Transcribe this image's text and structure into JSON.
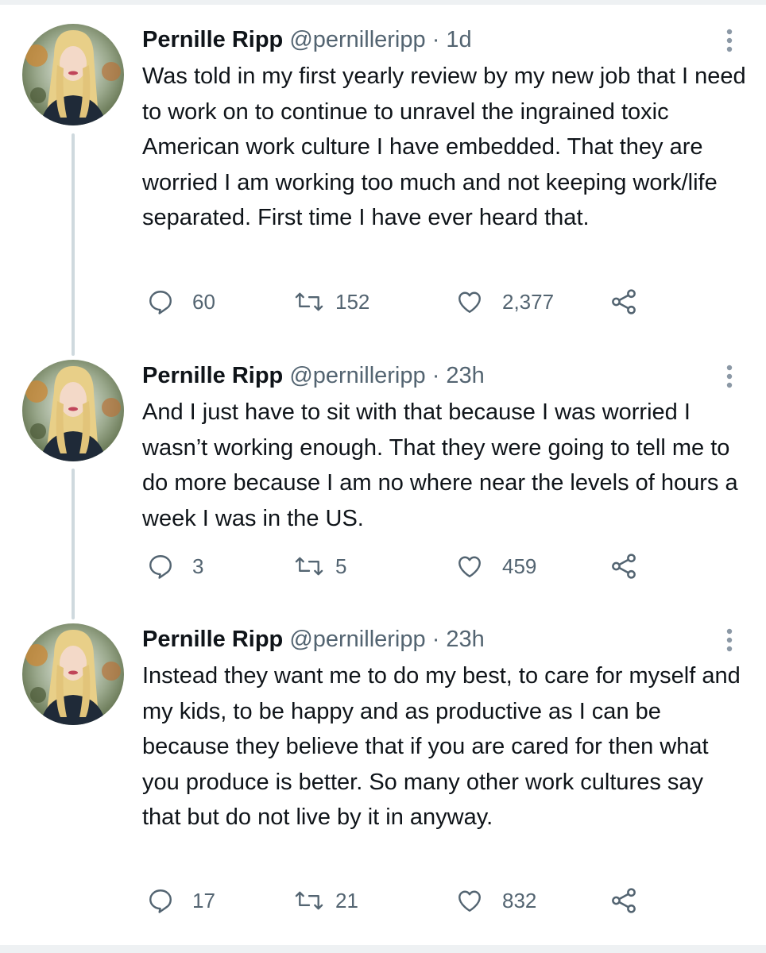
{
  "tweets": [
    {
      "name": "Pernille Ripp",
      "handle": "@pernilleripp",
      "separator": "·",
      "time": "1d",
      "text": "Was told in my first yearly review by my new job that I need to work on to continue to unravel the ingrained toxic American work culture I have embedded. That they are worried I am working too much and not keeping work/life separated. First time I have ever heard that.",
      "replies": "60",
      "retweets": "152",
      "likes": "2,377"
    },
    {
      "name": "Pernille Ripp",
      "handle": "@pernilleripp",
      "separator": "·",
      "time": "23h",
      "text": "And I just have to sit with that because I was worried I wasn’t working enough. That they were going to tell me to do more because I am no where near the levels of hours a week I was in the US.",
      "replies": "3",
      "retweets": "5",
      "likes": "459"
    },
    {
      "name": "Pernille Ripp",
      "handle": "@pernilleripp",
      "separator": "·",
      "time": "23h",
      "text": "Instead they want me to do my best, to care for myself and my kids, to be happy and as productive as I can be because they believe that if you are cared for then what you produce is better. So many other work cultures say that but do not live by it in anyway.",
      "replies": "17",
      "retweets": "21",
      "likes": "832"
    }
  ],
  "icons": {
    "reply": "reply-icon",
    "retweet": "retweet-icon",
    "like": "heart-icon",
    "share": "share-icon",
    "more": "more-vertical-icon"
  },
  "colors": {
    "text": "#0f1419",
    "secondary": "#536471",
    "thread_line": "#cfd9de"
  }
}
